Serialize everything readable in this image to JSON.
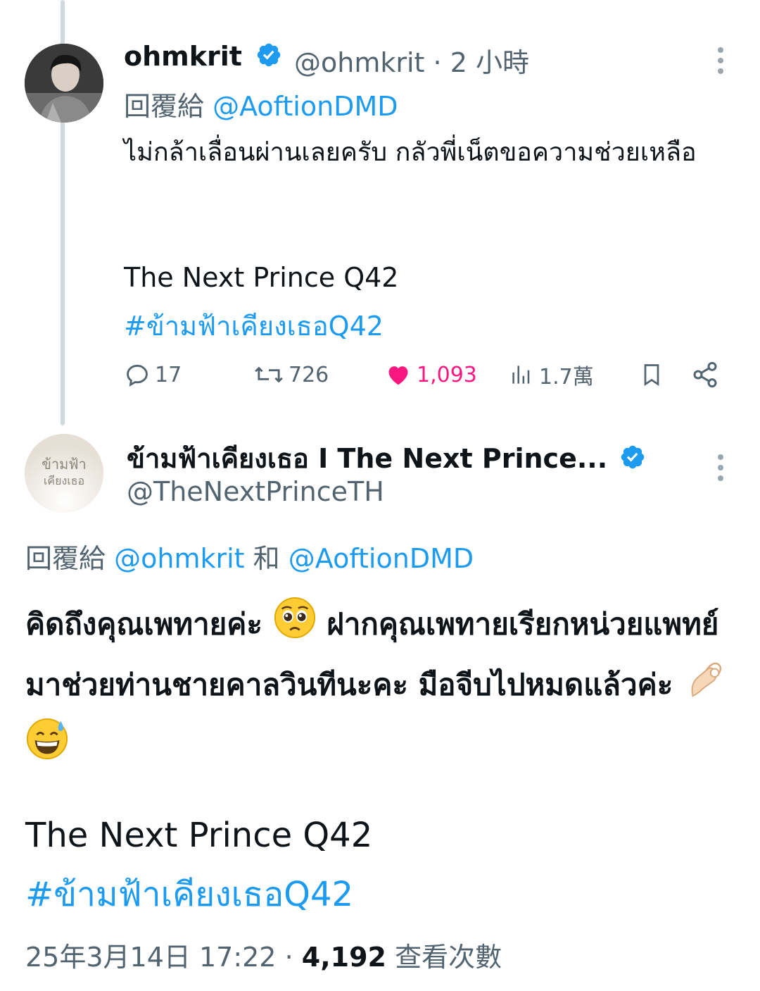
{
  "tweet1": {
    "display_name": "ohmkrit",
    "handle": "@ohmkrit",
    "dot": "·",
    "time": "2 小時",
    "reply_label": "回覆給",
    "reply_mention": "@AoftionDMD",
    "text": "ไม่กล้าเลื่อนผ่านเลยครับ กลัวพี่เน็ตขอความช่วยเหลือ",
    "line2": "The Next Prince Q42",
    "hashtag": "#ข้ามฟ้าเคียงเธอQ42",
    "stats": {
      "replies": "17",
      "reposts": "726",
      "likes": "1,093",
      "views": "1.7萬"
    },
    "like_color": "#f91880",
    "accent": "#1d9bf0"
  },
  "tweet2": {
    "display_name": "ข้ามฟ้าเคียงเธอ I The Next Prince...",
    "handle": "@TheNextPrinceTH",
    "avatar_text_line1": "ข้ามฟ้า",
    "avatar_text_line2": "เคียงเธอ",
    "reply_label": "回覆給",
    "reply_mention1": "@ohmkrit",
    "reply_and": "和",
    "reply_mention2": "@AoftionDMD",
    "text_part1": "คิดถึงคุณเพทายค่ะ",
    "text_part2": "ฝากคุณเพทายเรียกหน่วยแพทย์มาช่วยท่านชายคาลวินทีนะคะ มือจีบไปหมดแล้วค่ะ",
    "emoji1": "pleading-face",
    "emoji2": "pinching-hand",
    "emoji3": "grinning-sweat-face",
    "line2": "The Next Prince Q42",
    "hashtag": "#ข้ามฟ้าเคียงเธอQ42",
    "timestamp": "25年3月14日 17:22",
    "dot": "·",
    "views_count": "4,192",
    "views_label": "查看次數"
  }
}
